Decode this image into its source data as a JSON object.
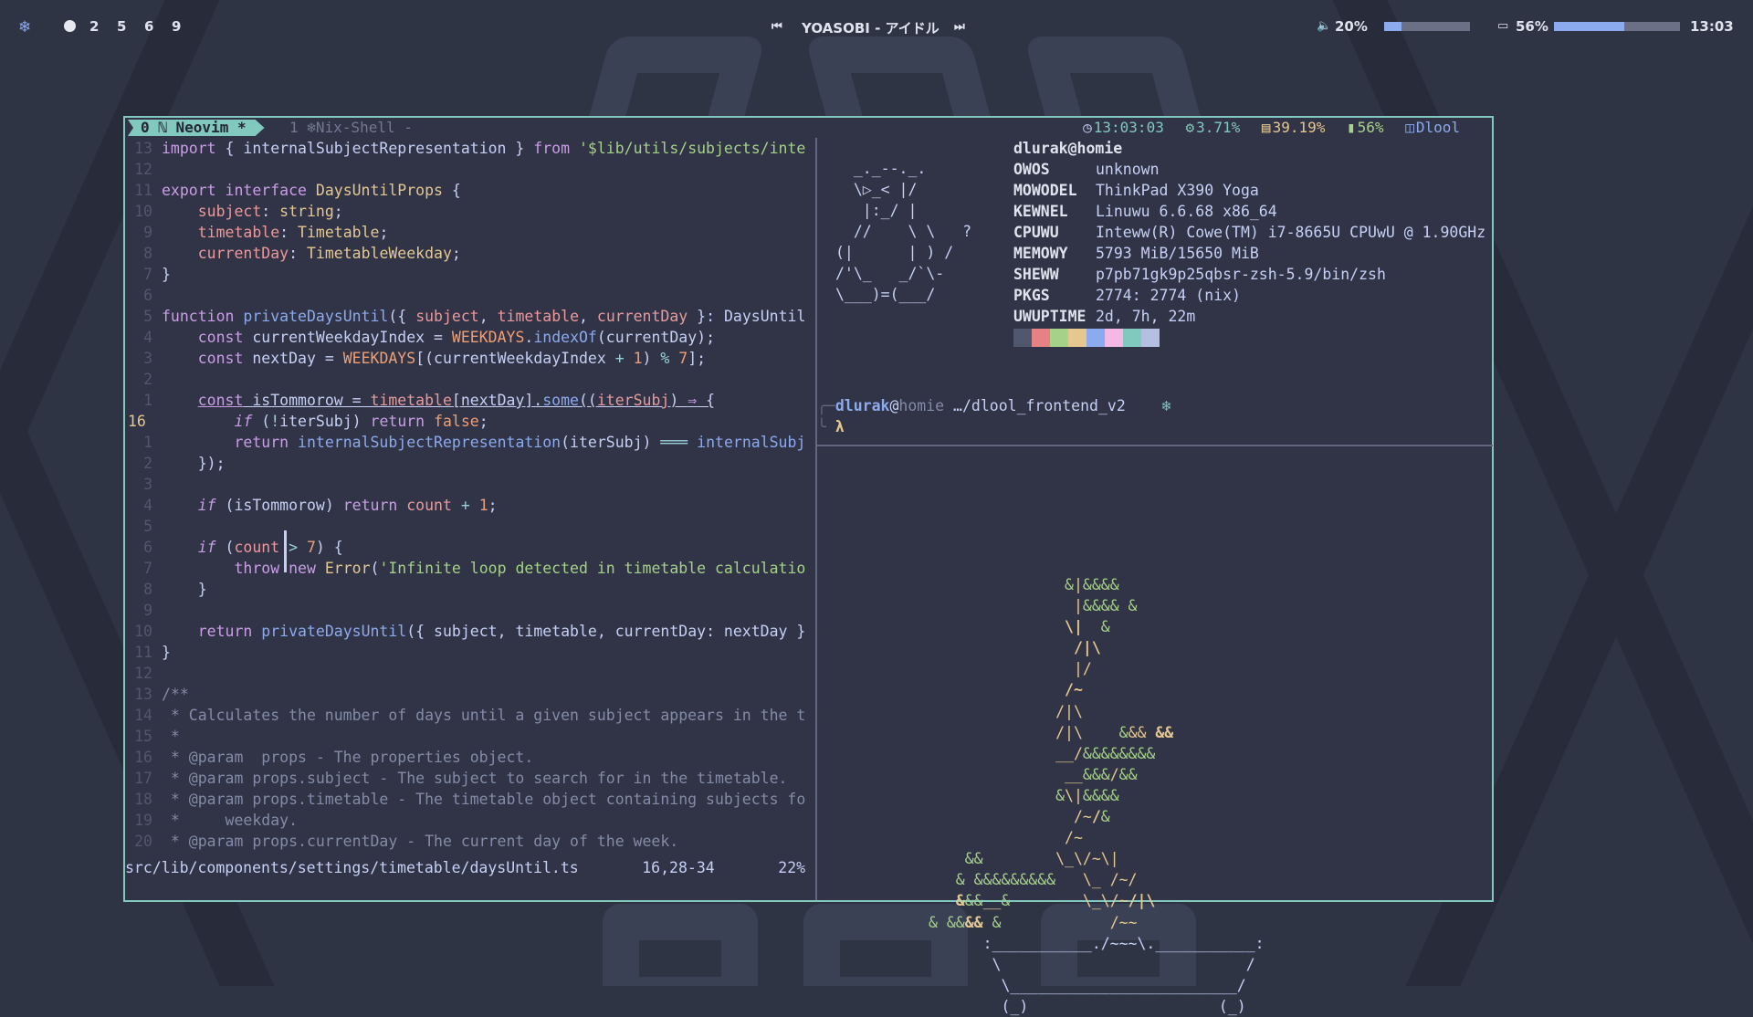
{
  "topbar": {
    "workspaces": [
      "2",
      "5",
      "6",
      "9"
    ],
    "media_title": "YOASOBI - アイドル",
    "volume": "20%",
    "volume_level": 0.2,
    "battery": "56%",
    "battery_level": 0.56,
    "clock": "13:03"
  },
  "tmux": {
    "tab0": "0 ℕ Neovim *",
    "tab1": "1 ❄Nix-Shell -",
    "time": "13:03:03",
    "cpu": "3.71%",
    "mem": "39.19%",
    "battery": "56%",
    "session": "Dlool"
  },
  "editor": {
    "status_path": "src/lib/components/settings/timetable/daysUntil.ts",
    "status_pos": "16,28-34",
    "status_pct": "22%"
  },
  "fetch": {
    "user_host": "dlurak@homie",
    "rows": [
      {
        "key": "OWOS",
        "value": "unknown"
      },
      {
        "key": "MOWODEL",
        "value": "ThinkPad X390 Yoga"
      },
      {
        "key": "KEWNEL",
        "value": "Linuwu 6.6.68 x86_64"
      },
      {
        "key": "CPUWU",
        "value": "Inteww(R) Cowe(TM) i7-8665U CPUwU @ 1.90GHz"
      },
      {
        "key": "MEMOWY",
        "value": "5793 MiB/15650 MiB"
      },
      {
        "key": "SHEWW",
        "value": "p7pb71gk9p25qbsr-zsh-5.9/bin/zsh"
      },
      {
        "key": "PKGS",
        "value": "2774: 2774 (nix)"
      },
      {
        "key": "UWUPTIME",
        "value": "2d, 7h, 22m"
      }
    ],
    "palette": [
      "#51576d",
      "#e78284",
      "#a6d189",
      "#e5c890",
      "#8caaee",
      "#f4b8e4",
      "#81c8be",
      "#b5bfe2"
    ]
  },
  "prompt": {
    "user": "dlurak",
    "host": "homie",
    "path": "…/dlool_frontend_v2",
    "symbol": "λ"
  }
}
